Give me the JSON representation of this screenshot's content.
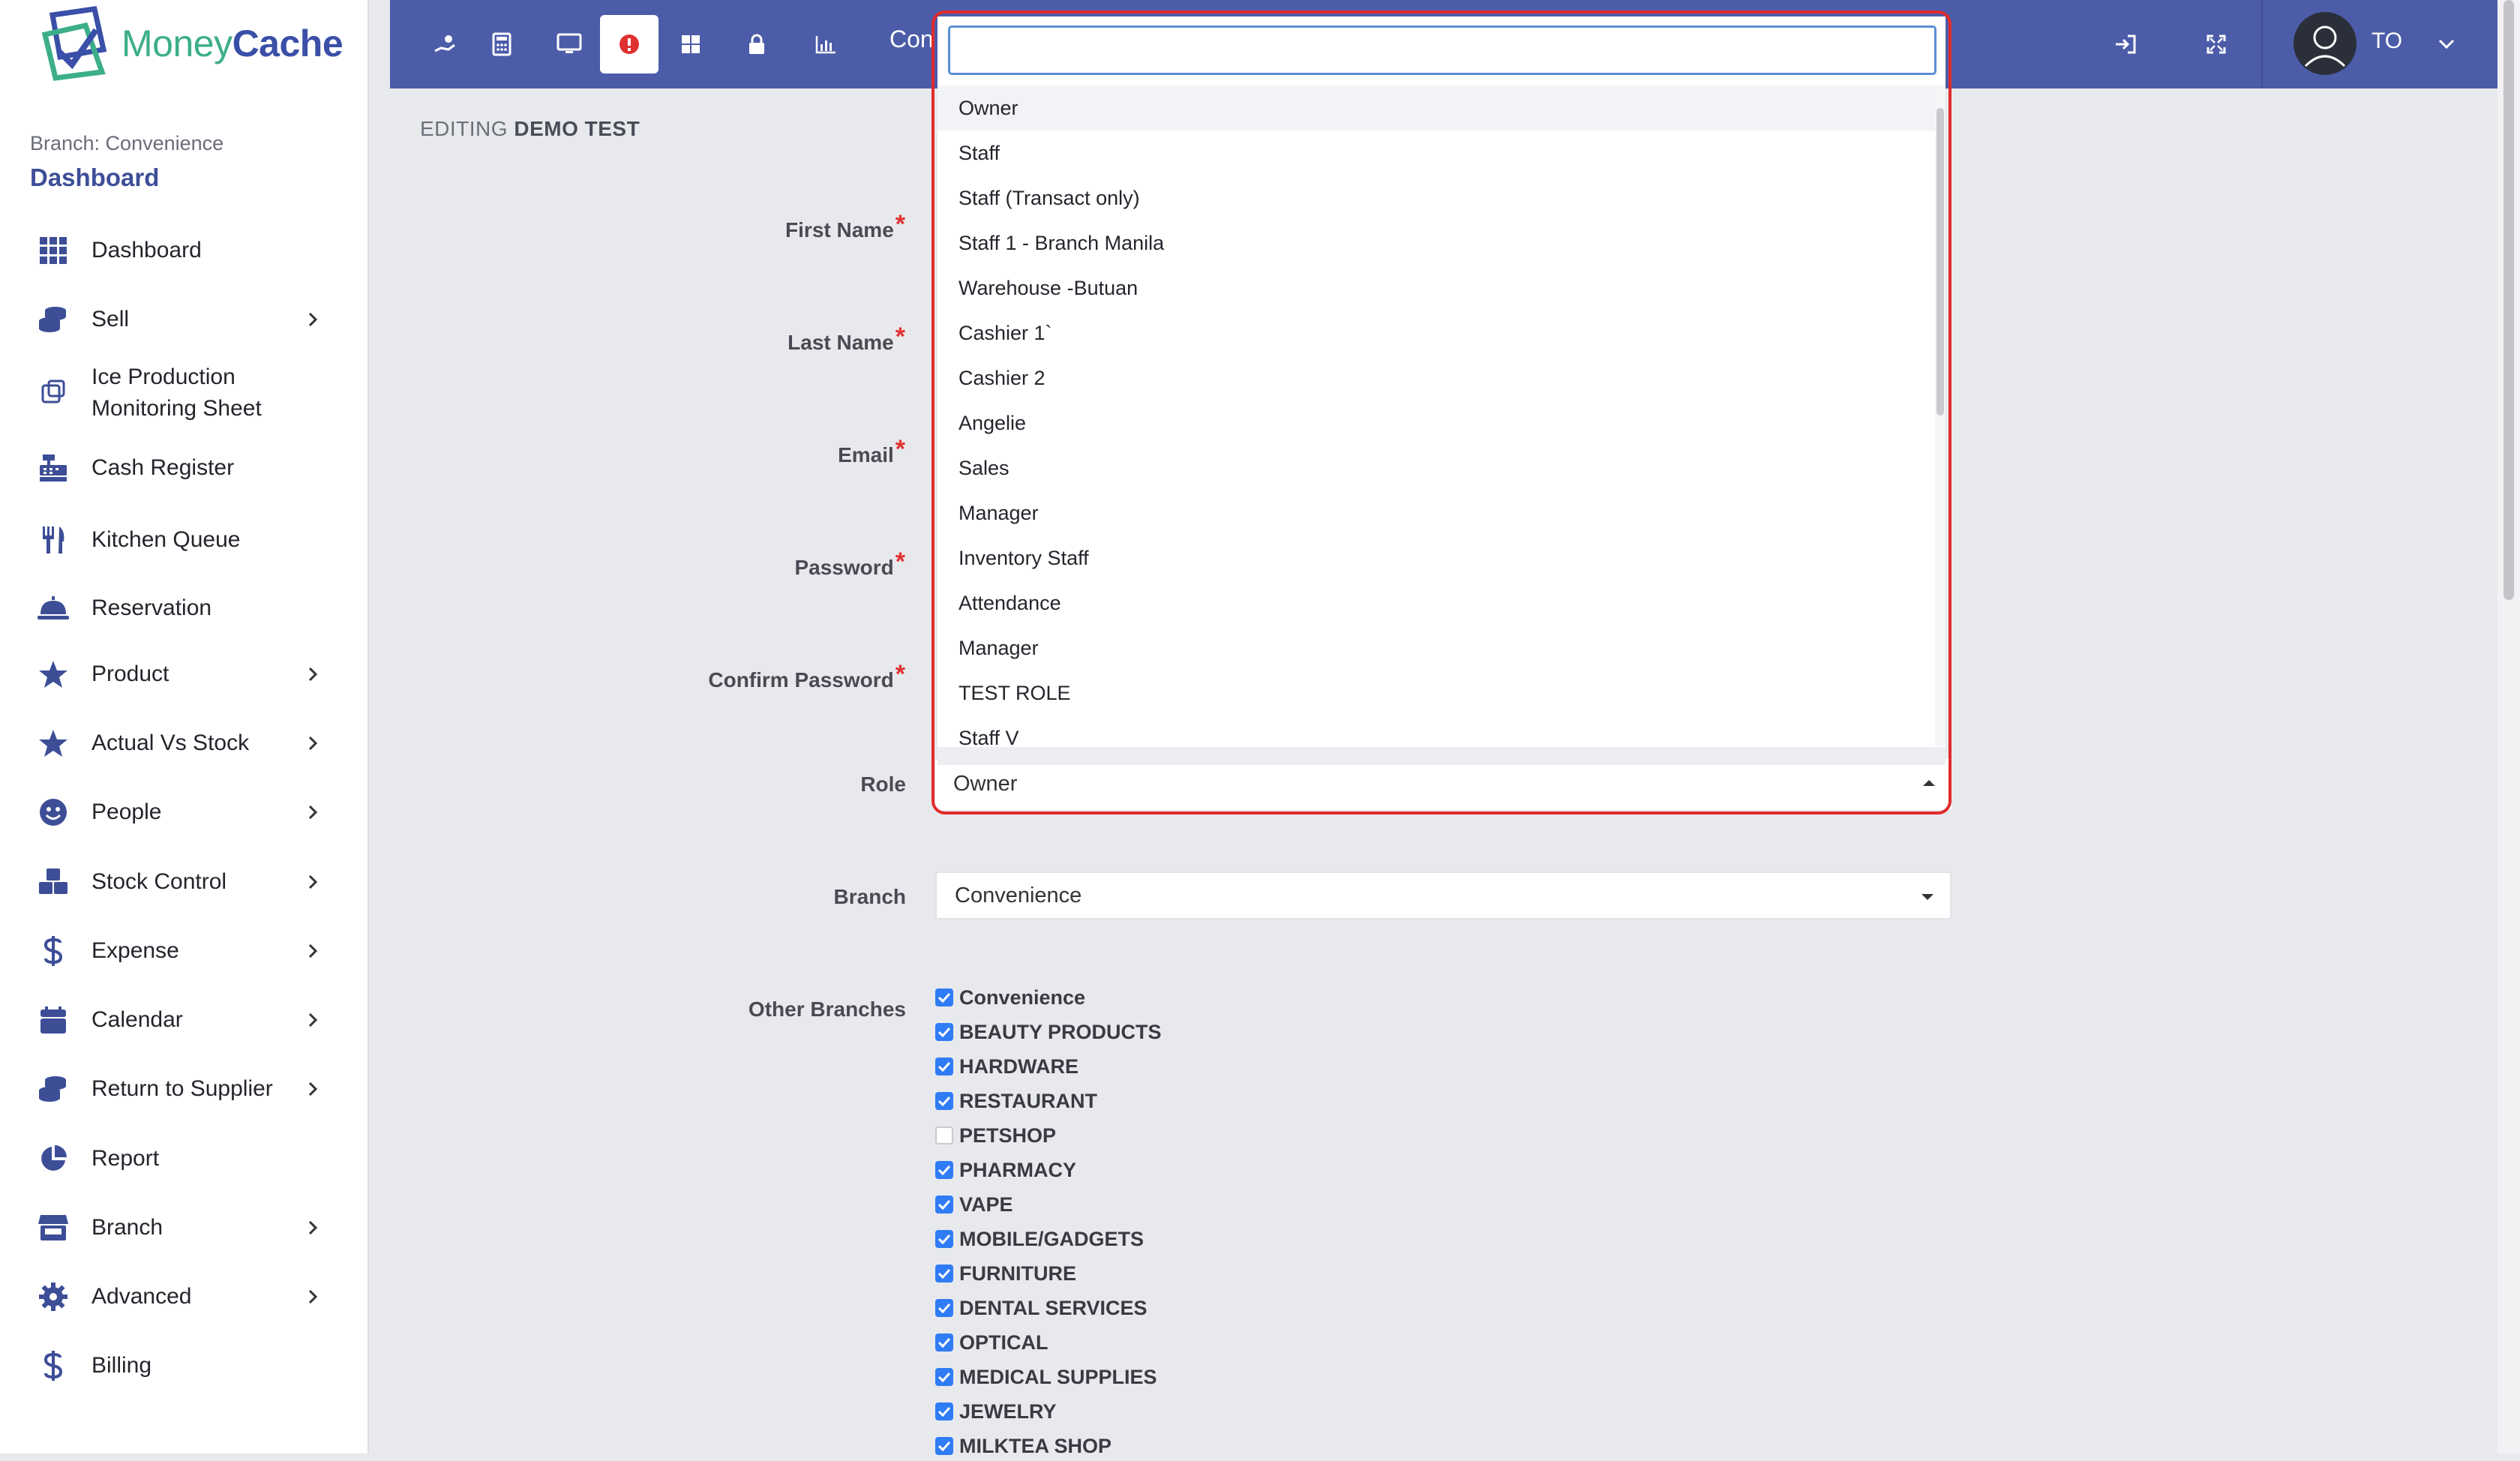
{
  "brand": {
    "name_part1": "Money",
    "name_part2": "Cache"
  },
  "sidebar": {
    "branch_line": "Branch: Convenience",
    "sub_title": "Dashboard",
    "items": [
      {
        "label": "Dashboard",
        "icon": "grid-icon",
        "chevron": false
      },
      {
        "label": "Sell",
        "icon": "coins-icon",
        "chevron": true
      },
      {
        "label": "Ice Production\nMonitoring Sheet",
        "icon": "ice-cube-icon",
        "chevron": false
      },
      {
        "label": "Cash Register",
        "icon": "cash-register-icon",
        "chevron": false
      },
      {
        "label": "Kitchen Queue",
        "icon": "utensils-icon",
        "chevron": false
      },
      {
        "label": "Reservation",
        "icon": "bell-icon",
        "chevron": false
      },
      {
        "label": "Product",
        "icon": "star-icon",
        "chevron": true
      },
      {
        "label": "Actual Vs Stock",
        "icon": "star-icon",
        "chevron": true
      },
      {
        "label": "People",
        "icon": "smile-icon",
        "chevron": true
      },
      {
        "label": "Stock Control",
        "icon": "boxes-icon",
        "chevron": true
      },
      {
        "label": "Expense",
        "icon": "dollar-icon",
        "chevron": true
      },
      {
        "label": "Calendar",
        "icon": "calendar-icon",
        "chevron": true
      },
      {
        "label": "Return to Supplier",
        "icon": "coins-icon",
        "chevron": true
      },
      {
        "label": "Report",
        "icon": "pie-chart-icon",
        "chevron": false
      },
      {
        "label": "Branch",
        "icon": "store-icon",
        "chevron": true
      },
      {
        "label": "Advanced",
        "icon": "gear-icon",
        "chevron": true
      },
      {
        "label": "Billing",
        "icon": "dollar-icon",
        "chevron": false
      }
    ]
  },
  "topbar": {
    "title": "Con",
    "user_initials": "TO",
    "colors": {
      "bar": "#4c5ca9",
      "alert": "#e03131"
    }
  },
  "form": {
    "heading_prefix": "EDITING",
    "heading_name": "DEMO TEST",
    "labels": {
      "first_name": "First Name",
      "last_name": "Last Name",
      "email": "Email",
      "password": "Password",
      "confirm_password": "Confirm Password",
      "role": "Role",
      "branch": "Branch",
      "other_branches": "Other Branches"
    },
    "required_mark": "*",
    "role_value": "Owner",
    "branch_value": "Convenience"
  },
  "role_dropdown": {
    "search_value": "",
    "options": [
      "Owner",
      "Staff",
      "Staff (Transact only)",
      "Staff 1 - Branch Manila",
      "Warehouse -Butuan",
      "Cashier 1`",
      "Cashier 2",
      "Angelie",
      "Sales",
      "Manager",
      "Inventory Staff",
      "Attendance",
      "Manager",
      "TEST ROLE",
      "Staff V"
    ],
    "selected": "Owner"
  },
  "other_branches": [
    {
      "name": "Convenience",
      "checked": true
    },
    {
      "name": "BEAUTY PRODUCTS",
      "checked": true
    },
    {
      "name": "HARDWARE",
      "checked": true
    },
    {
      "name": "RESTAURANT",
      "checked": true
    },
    {
      "name": "PETSHOP",
      "checked": false
    },
    {
      "name": "PHARMACY",
      "checked": true
    },
    {
      "name": "VAPE",
      "checked": true
    },
    {
      "name": "MOBILE/GADGETS",
      "checked": true
    },
    {
      "name": "FURNITURE",
      "checked": true
    },
    {
      "name": "DENTAL SERVICES",
      "checked": true
    },
    {
      "name": "OPTICAL",
      "checked": true
    },
    {
      "name": "MEDICAL SUPPLIES",
      "checked": true
    },
    {
      "name": "JEWELRY",
      "checked": true
    },
    {
      "name": "MILKTEA SHOP",
      "checked": true
    }
  ]
}
